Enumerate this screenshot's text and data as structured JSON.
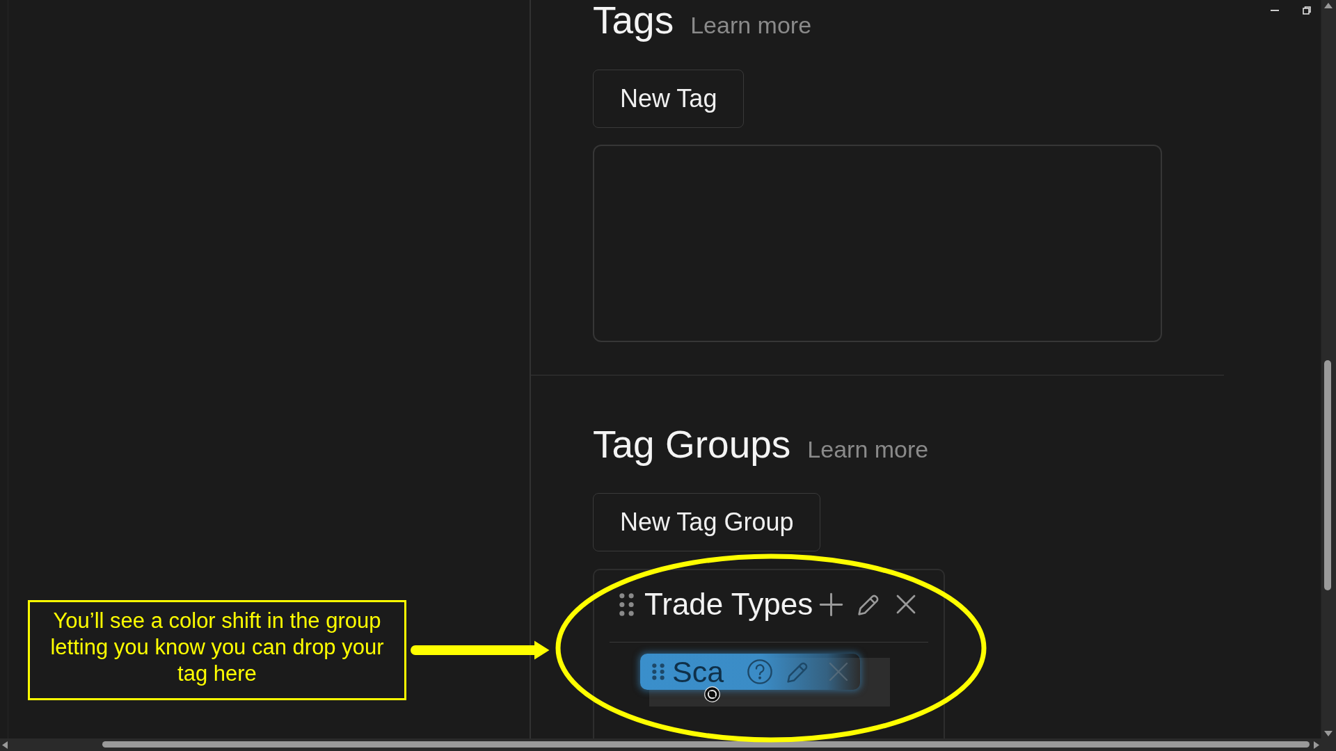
{
  "tags_section": {
    "title": "Tags",
    "learn_more": "Learn more",
    "new_button": "New Tag"
  },
  "tag_groups_section": {
    "title": "Tag Groups",
    "learn_more": "Learn more",
    "new_button": "New Tag Group",
    "groups": [
      {
        "name": "Trade Types",
        "tags": [
          {
            "label": "Sca",
            "dragging": true
          }
        ]
      }
    ]
  },
  "annotation": {
    "text": "You’ll see a color shift in the group letting you know you can drop your tag here"
  }
}
